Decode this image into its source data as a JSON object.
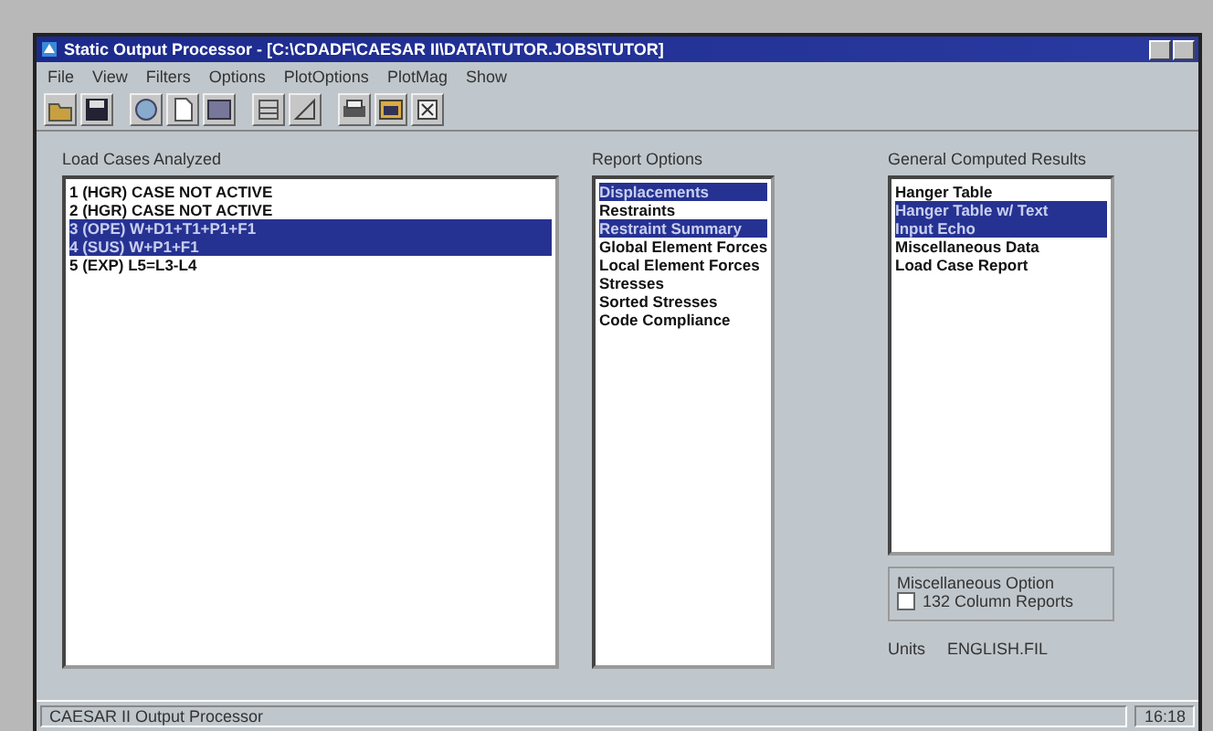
{
  "window": {
    "title": "Static Output Processor - [C:\\CDADF\\CAESAR II\\DATA\\TUTOR.JOBS\\TUTOR]"
  },
  "menu": [
    "File",
    "View",
    "Filters",
    "Options",
    "PlotOptions",
    "PlotMag",
    "Show"
  ],
  "load_cases": {
    "title": "Load Cases Analyzed",
    "items": [
      {
        "label": "1 (HGR) CASE NOT ACTIVE",
        "selected": false
      },
      {
        "label": "2 (HGR) CASE NOT ACTIVE",
        "selected": false
      },
      {
        "label": "3 (OPE) W+D1+T1+P1+F1",
        "selected": true
      },
      {
        "label": "4 (SUS) W+P1+F1",
        "selected": true
      },
      {
        "label": "5 (EXP) L5=L3-L4",
        "selected": false
      }
    ]
  },
  "report_options": {
    "title": "Report Options",
    "items": [
      {
        "label": "Displacements",
        "selected": true
      },
      {
        "label": "Restraints",
        "selected": false
      },
      {
        "label": "Restraint Summary",
        "selected": true
      },
      {
        "label": "Global Element Forces",
        "selected": false
      },
      {
        "label": "Local Element Forces",
        "selected": false
      },
      {
        "label": "Stresses",
        "selected": false
      },
      {
        "label": "Sorted Stresses",
        "selected": false
      },
      {
        "label": "Code Compliance",
        "selected": false
      }
    ]
  },
  "general_results": {
    "title": "General Computed Results",
    "items": [
      {
        "label": "Hanger Table",
        "selected": false
      },
      {
        "label": "Hanger Table w/ Text",
        "selected": true
      },
      {
        "label": "Input Echo",
        "selected": true
      },
      {
        "label": "Miscellaneous Data",
        "selected": false
      },
      {
        "label": "Load Case Report",
        "selected": false
      }
    ]
  },
  "misc_option": {
    "title": "Miscellaneous Option",
    "label": "132 Column Reports",
    "checked": false
  },
  "units": {
    "label": "Units",
    "value": "ENGLISH.FIL"
  },
  "status_bar": {
    "text": "CAESAR II Output Processor",
    "time": "16:18"
  }
}
